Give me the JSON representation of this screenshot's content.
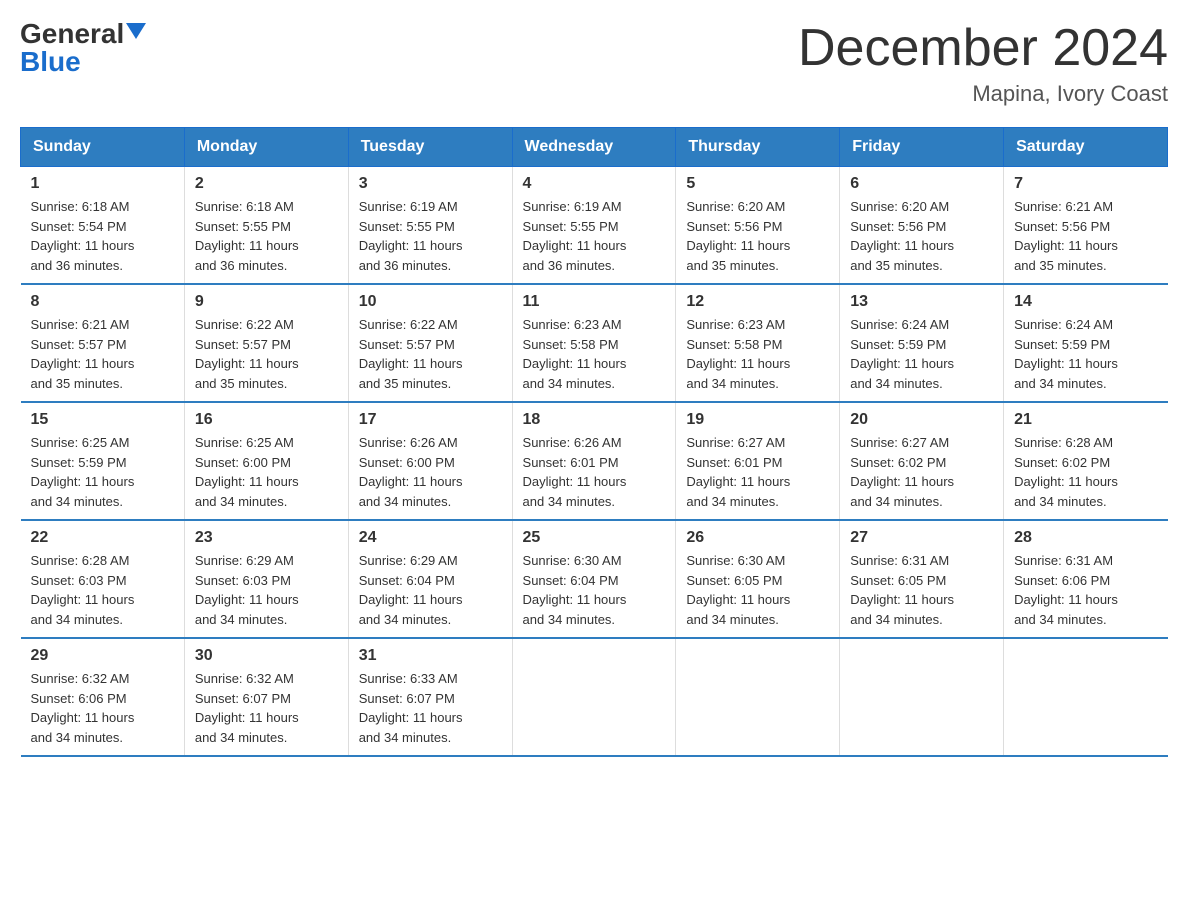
{
  "logo": {
    "general": "General",
    "blue": "Blue"
  },
  "header": {
    "month_year": "December 2024",
    "location": "Mapina, Ivory Coast"
  },
  "days_of_week": [
    "Sunday",
    "Monday",
    "Tuesday",
    "Wednesday",
    "Thursday",
    "Friday",
    "Saturday"
  ],
  "weeks": [
    [
      {
        "day": "1",
        "sunrise": "6:18 AM",
        "sunset": "5:54 PM",
        "daylight": "11 hours and 36 minutes."
      },
      {
        "day": "2",
        "sunrise": "6:18 AM",
        "sunset": "5:55 PM",
        "daylight": "11 hours and 36 minutes."
      },
      {
        "day": "3",
        "sunrise": "6:19 AM",
        "sunset": "5:55 PM",
        "daylight": "11 hours and 36 minutes."
      },
      {
        "day": "4",
        "sunrise": "6:19 AM",
        "sunset": "5:55 PM",
        "daylight": "11 hours and 36 minutes."
      },
      {
        "day": "5",
        "sunrise": "6:20 AM",
        "sunset": "5:56 PM",
        "daylight": "11 hours and 35 minutes."
      },
      {
        "day": "6",
        "sunrise": "6:20 AM",
        "sunset": "5:56 PM",
        "daylight": "11 hours and 35 minutes."
      },
      {
        "day": "7",
        "sunrise": "6:21 AM",
        "sunset": "5:56 PM",
        "daylight": "11 hours and 35 minutes."
      }
    ],
    [
      {
        "day": "8",
        "sunrise": "6:21 AM",
        "sunset": "5:57 PM",
        "daylight": "11 hours and 35 minutes."
      },
      {
        "day": "9",
        "sunrise": "6:22 AM",
        "sunset": "5:57 PM",
        "daylight": "11 hours and 35 minutes."
      },
      {
        "day": "10",
        "sunrise": "6:22 AM",
        "sunset": "5:57 PM",
        "daylight": "11 hours and 35 minutes."
      },
      {
        "day": "11",
        "sunrise": "6:23 AM",
        "sunset": "5:58 PM",
        "daylight": "11 hours and 34 minutes."
      },
      {
        "day": "12",
        "sunrise": "6:23 AM",
        "sunset": "5:58 PM",
        "daylight": "11 hours and 34 minutes."
      },
      {
        "day": "13",
        "sunrise": "6:24 AM",
        "sunset": "5:59 PM",
        "daylight": "11 hours and 34 minutes."
      },
      {
        "day": "14",
        "sunrise": "6:24 AM",
        "sunset": "5:59 PM",
        "daylight": "11 hours and 34 minutes."
      }
    ],
    [
      {
        "day": "15",
        "sunrise": "6:25 AM",
        "sunset": "5:59 PM",
        "daylight": "11 hours and 34 minutes."
      },
      {
        "day": "16",
        "sunrise": "6:25 AM",
        "sunset": "6:00 PM",
        "daylight": "11 hours and 34 minutes."
      },
      {
        "day": "17",
        "sunrise": "6:26 AM",
        "sunset": "6:00 PM",
        "daylight": "11 hours and 34 minutes."
      },
      {
        "day": "18",
        "sunrise": "6:26 AM",
        "sunset": "6:01 PM",
        "daylight": "11 hours and 34 minutes."
      },
      {
        "day": "19",
        "sunrise": "6:27 AM",
        "sunset": "6:01 PM",
        "daylight": "11 hours and 34 minutes."
      },
      {
        "day": "20",
        "sunrise": "6:27 AM",
        "sunset": "6:02 PM",
        "daylight": "11 hours and 34 minutes."
      },
      {
        "day": "21",
        "sunrise": "6:28 AM",
        "sunset": "6:02 PM",
        "daylight": "11 hours and 34 minutes."
      }
    ],
    [
      {
        "day": "22",
        "sunrise": "6:28 AM",
        "sunset": "6:03 PM",
        "daylight": "11 hours and 34 minutes."
      },
      {
        "day": "23",
        "sunrise": "6:29 AM",
        "sunset": "6:03 PM",
        "daylight": "11 hours and 34 minutes."
      },
      {
        "day": "24",
        "sunrise": "6:29 AM",
        "sunset": "6:04 PM",
        "daylight": "11 hours and 34 minutes."
      },
      {
        "day": "25",
        "sunrise": "6:30 AM",
        "sunset": "6:04 PM",
        "daylight": "11 hours and 34 minutes."
      },
      {
        "day": "26",
        "sunrise": "6:30 AM",
        "sunset": "6:05 PM",
        "daylight": "11 hours and 34 minutes."
      },
      {
        "day": "27",
        "sunrise": "6:31 AM",
        "sunset": "6:05 PM",
        "daylight": "11 hours and 34 minutes."
      },
      {
        "day": "28",
        "sunrise": "6:31 AM",
        "sunset": "6:06 PM",
        "daylight": "11 hours and 34 minutes."
      }
    ],
    [
      {
        "day": "29",
        "sunrise": "6:32 AM",
        "sunset": "6:06 PM",
        "daylight": "11 hours and 34 minutes."
      },
      {
        "day": "30",
        "sunrise": "6:32 AM",
        "sunset": "6:07 PM",
        "daylight": "11 hours and 34 minutes."
      },
      {
        "day": "31",
        "sunrise": "6:33 AM",
        "sunset": "6:07 PM",
        "daylight": "11 hours and 34 minutes."
      },
      null,
      null,
      null,
      null
    ]
  ],
  "labels": {
    "sunrise": "Sunrise:",
    "sunset": "Sunset:",
    "daylight": "Daylight:"
  }
}
